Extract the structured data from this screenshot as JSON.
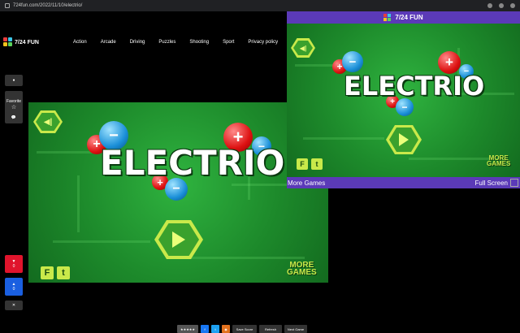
{
  "browser": {
    "url": "724fun.com/2022/11/10/electrio/"
  },
  "site": {
    "logo_text": "7/24 FUN",
    "nav": [
      "Action",
      "Arcade",
      "Driving",
      "Puzzles",
      "Shooting",
      "Sport",
      "Privacy policy"
    ]
  },
  "sidebar": {
    "favorite_label": "Favorite",
    "star": "☆",
    "like_count": "0",
    "dislike_count": "0"
  },
  "game": {
    "title": "ELECTRIO",
    "more_line1": "MORE",
    "more_line2": "GAMES",
    "f_label": "F",
    "t_label": "t"
  },
  "popup": {
    "title": "7/24 FUN",
    "more_games": "More Games",
    "full_screen": "Full Screen"
  },
  "bottom": {
    "save_score": "Save Score",
    "refresh": "Refresh",
    "next_game": "Next Game"
  },
  "colors": {
    "purple": "#5b3ab8",
    "green": "#1f8a2c",
    "red": "#e0142c",
    "blue": "#1a5fe0"
  }
}
